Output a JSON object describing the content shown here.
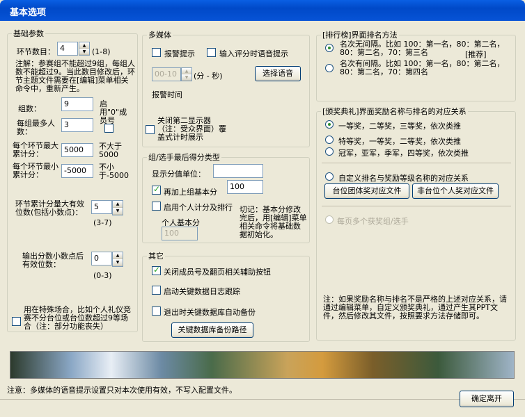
{
  "window": {
    "title": "基本选项"
  },
  "basic": {
    "legend": "基础参数",
    "section_count_label": "环节数目：",
    "section_count_value": "4",
    "section_count_range": "(1-8)",
    "note": "注解：参赛组不能超过9组，每组人数不能超过9。当此数目修改后，环节主题文件需要在[编辑]菜单相关命令中，重新产生。",
    "group_count_label": "组数：",
    "group_count_value": "9",
    "enable_zero_label": "启用\"0\"成员号",
    "members_label": "每组最多人数：",
    "members_value": "3",
    "max_score_label": "每个环节最大累计分：",
    "max_score_value": "5000",
    "max_score_hint": "不大于5000",
    "min_score_label": "每个环节最小累计分：",
    "min_score_value": "-5000",
    "min_score_hint": "不小于-5000",
    "digits_label": "环节累计分量大有效位数(包括小数点)：",
    "digits_value": "5",
    "digits_range": "(3-7)",
    "decimal_label": "输出分数小数点后有效位数：",
    "decimal_value": "0",
    "decimal_range": "(0-3)",
    "special_label": "用在特殊场合，比如个人礼仪竞赛不分台位或台位数超过9等场合（注：部分功能丧失）"
  },
  "multimedia": {
    "legend": "多媒体",
    "alarm_prompt": "报警提示",
    "voice_prompt": "输入评分时语音提示",
    "time_value": "00-10",
    "time_unit": "(分 - 秒)",
    "select_voice": "选择语音",
    "alarm_time": "报警时间",
    "close_second_display": "关闭第二显示器（注：受众界面）覆盖式计时展示"
  },
  "score_type": {
    "legend": "组/选手最后得分类型",
    "unit_label": "显示分值单位：",
    "unit_value": "",
    "add_group_base": "再加上组基本分",
    "group_base_value": "100",
    "enable_individual": "启用个人计分及排行",
    "individual_base_label": "个人基本分",
    "individual_base_value": "100",
    "warning": "切记：基本分修改完后，用[编辑]菜单相关命令将基础数据初始化。"
  },
  "other": {
    "legend": "其它",
    "close_member_buttons": "关闭成员号及翻页相关辅助按钮",
    "enable_log": "启动关键数据日志跟踪",
    "auto_backup": "退出时关键数据库自动备份",
    "backup_path": "关键数据库备份路径"
  },
  "ranking": {
    "legend": "[排行榜]界面排名方法",
    "option1": "名次无间隔。比如 100：第一名，80：第二名，80：第二名，70：第三名",
    "recommended": "[推荐]",
    "option2": "名次有间隔。比如 100：第一名，80：第二名，80：第二名，70：第四名"
  },
  "awards": {
    "legend": "[颁奖典礼]界面奖励名称与排名的对应关系",
    "option1": "一等奖，二等奖，三等奖，依次类推",
    "option2": "特等奖，一等奖，二等奖，依次类推",
    "option3": "冠军，亚军，季军，四等奖，依次类推",
    "custom": "自定义排名与奖励等级名称的对应关系",
    "team_file": "台位团体奖对应文件",
    "individual_file": "非台位个人奖对应文件",
    "multi_per_page": "每页多个获奖组/选手",
    "note": "注：如果奖励名称与排名不是严格的上述对应关系，请通过编辑菜单，自定义颁奖典礼，通过产生其PPT文件，然后修改其文件，按照要求方法存储即可。"
  },
  "footer": {
    "notice": "注意：多媒体的语音提示设置只对本次使用有效，不写入配置文件。",
    "ok_button": "确定离开"
  }
}
